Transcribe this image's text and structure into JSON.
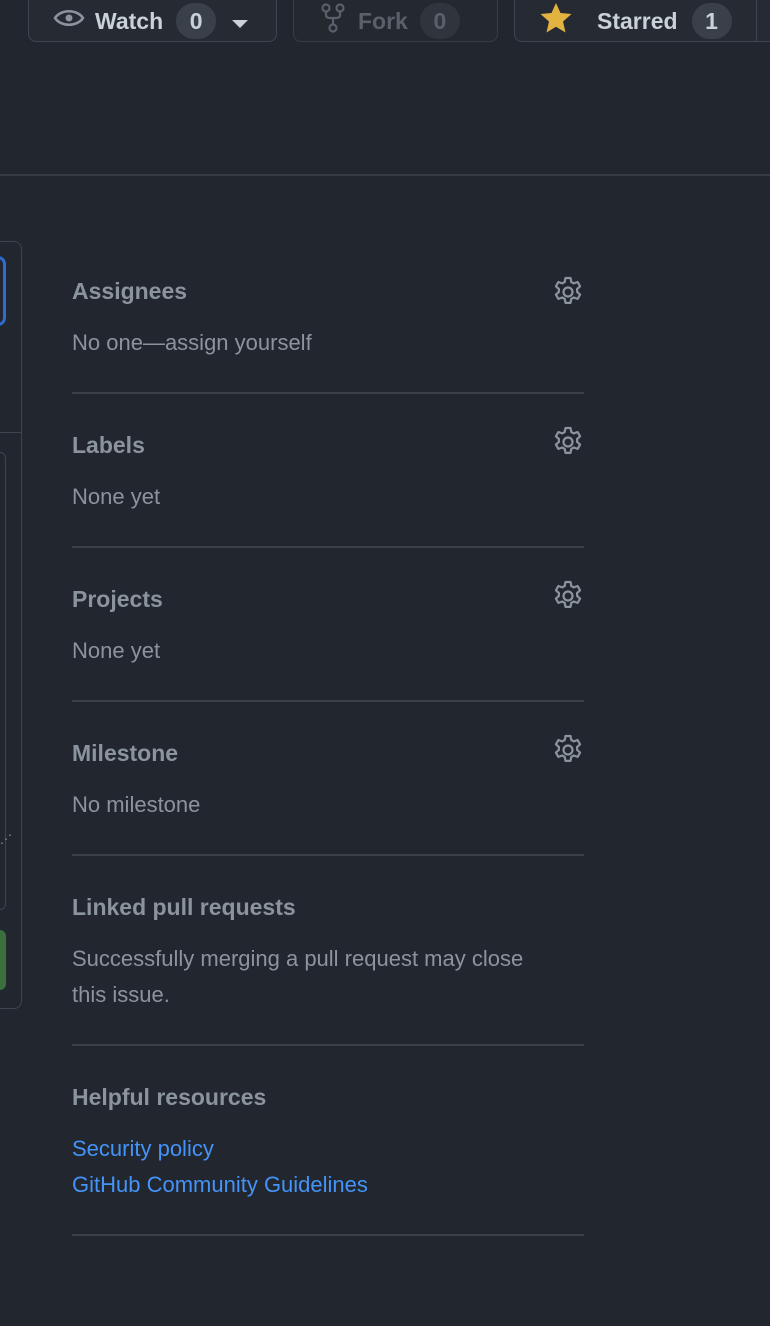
{
  "header": {
    "watch": {
      "label": "Watch",
      "count": "0"
    },
    "fork": {
      "label": "Fork",
      "count": "0"
    },
    "starred": {
      "label": "Starred",
      "count": "1"
    }
  },
  "sidebar": {
    "assignees": {
      "title": "Assignees",
      "value": "No one—assign yourself"
    },
    "labels": {
      "title": "Labels",
      "value": "None yet"
    },
    "projects": {
      "title": "Projects",
      "value": "None yet"
    },
    "milestone": {
      "title": "Milestone",
      "value": "No milestone"
    },
    "linked_prs": {
      "title": "Linked pull requests",
      "value": "Successfully merging a pull request may close this issue."
    },
    "resources": {
      "title": "Helpful resources",
      "links": [
        "Security policy",
        "GitHub Community Guidelines"
      ]
    }
  },
  "colors": {
    "background": "#22262e",
    "link": "#4493f8",
    "star": "#e3b341"
  }
}
